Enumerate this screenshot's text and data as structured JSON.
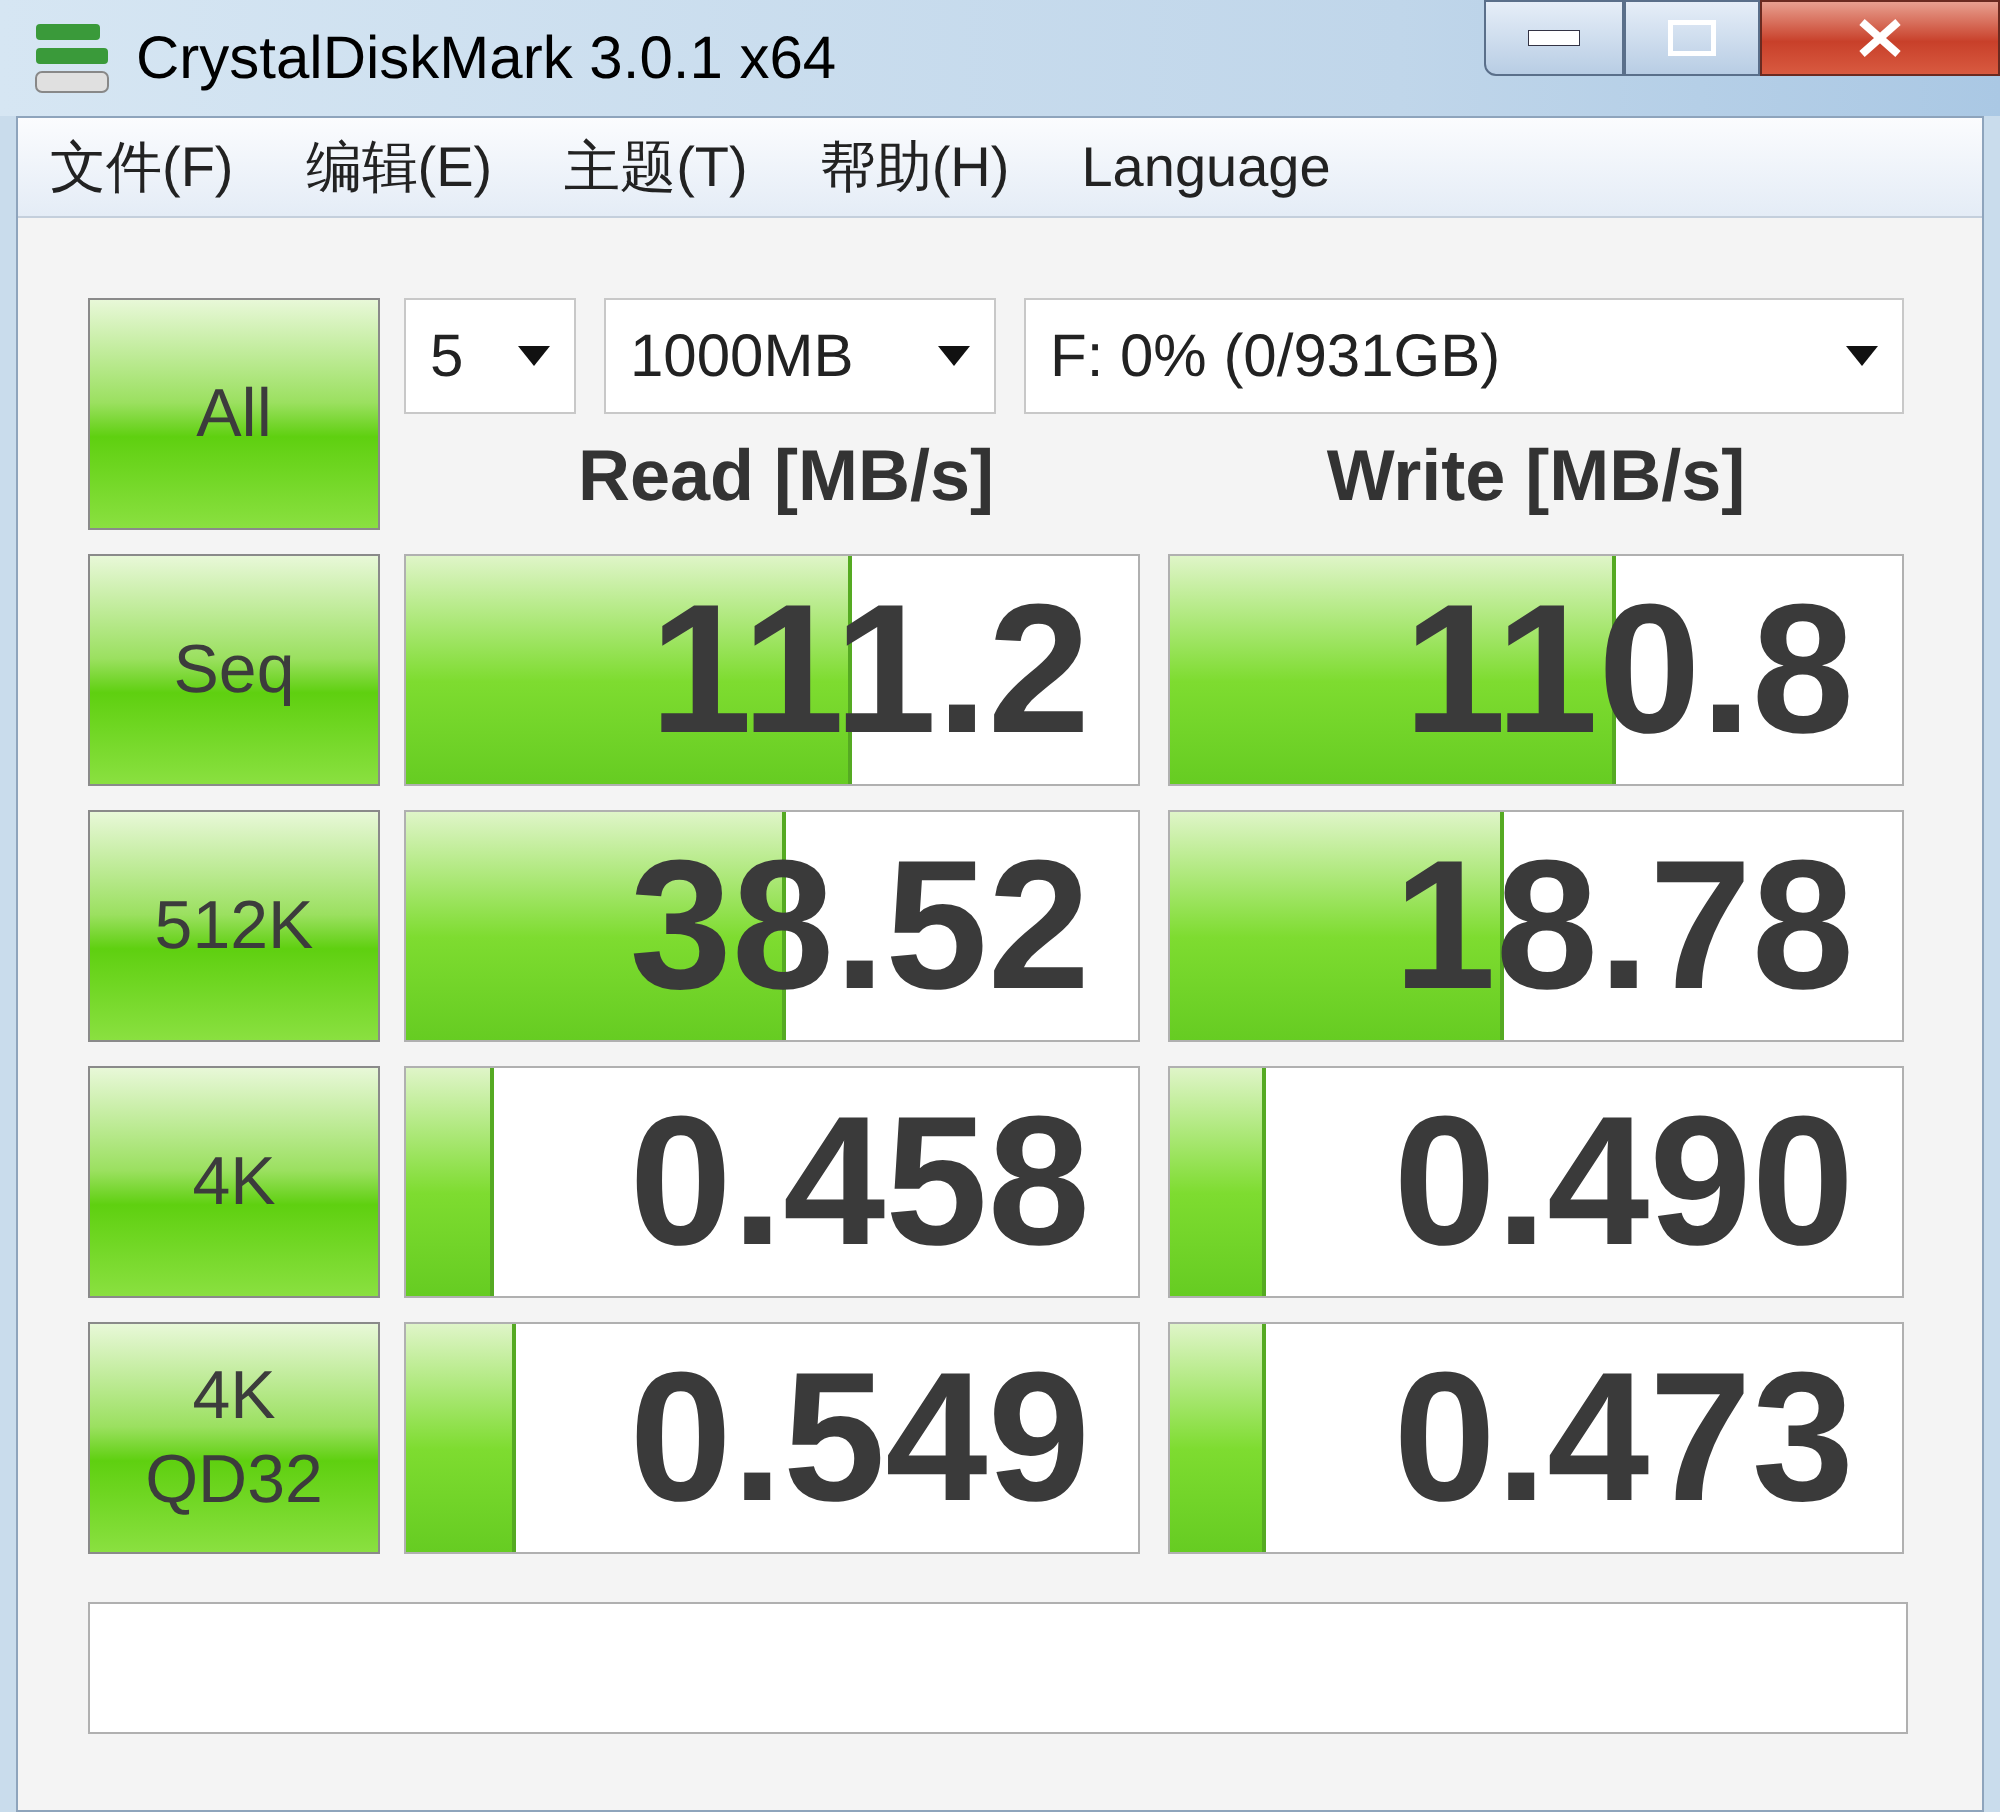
{
  "window": {
    "title": "CrystalDiskMark 3.0.1 x64"
  },
  "menu": [
    "文件(F)",
    "编辑(E)",
    "主题(T)",
    "帮助(H)",
    "Language"
  ],
  "controls": {
    "all_button": "All",
    "count": "5",
    "size": "1000MB",
    "drive": "F: 0% (0/931GB)"
  },
  "headers": {
    "read": "Read [MB/s]",
    "write": "Write [MB/s]"
  },
  "rows": [
    {
      "label": "Seq",
      "read": {
        "value": "111.2",
        "level": 0.61
      },
      "write": {
        "value": "110.8",
        "level": 0.61
      }
    },
    {
      "label": "512K",
      "read": {
        "value": "38.52",
        "level": 0.52
      },
      "write": {
        "value": "18.78",
        "level": 0.455
      }
    },
    {
      "label": "4K",
      "read": {
        "value": "0.458",
        "level": 0.12
      },
      "write": {
        "value": "0.490",
        "level": 0.13
      }
    },
    {
      "label": "4K\nQD32",
      "read": {
        "value": "0.549",
        "level": 0.15
      },
      "write": {
        "value": "0.473",
        "level": 0.13
      }
    }
  ]
}
